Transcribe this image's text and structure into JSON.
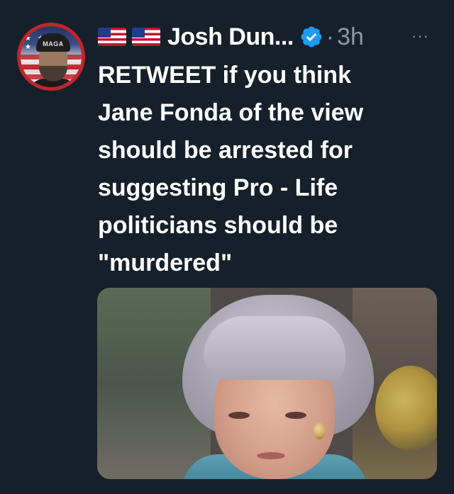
{
  "author": {
    "display_name": "Josh Dun...",
    "flags": [
      "us-flag",
      "us-flag"
    ],
    "verified": true,
    "timestamp": "3h",
    "separator": "·",
    "avatar_cap_text": "MAGA"
  },
  "tweet": {
    "text_lines": [
      "RETWEET if you think",
      "Jane Fonda of the view",
      "should be arrested for",
      "suggesting Pro - Life",
      "politicians should be",
      "\"murdered\""
    ],
    "has_media": true
  },
  "actions": {
    "more_label": "···"
  },
  "icons": {
    "verified": "verified-badge-icon",
    "more": "more-options-icon"
  },
  "colors": {
    "background": "#15202b",
    "text_primary": "#ffffff",
    "text_secondary": "#8b98a5",
    "verified_blue": "#1d9bf0"
  }
}
